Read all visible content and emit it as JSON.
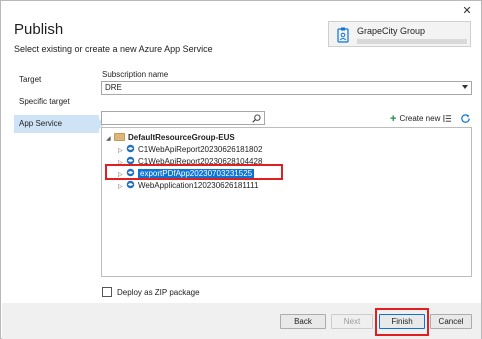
{
  "window": {
    "title": "Publish",
    "subtitle": "Select existing or create a new Azure App Service",
    "close_glyph": "✕"
  },
  "account": {
    "name": "GrapeCity Group",
    "icon": "account-badge-icon"
  },
  "sidebar": {
    "items": [
      {
        "label": "Target",
        "active": false
      },
      {
        "label": "Specific target",
        "active": false
      },
      {
        "label": "App Service",
        "active": true
      }
    ]
  },
  "subscription": {
    "label": "Subscription name",
    "value": "DRE"
  },
  "search": {
    "value": "",
    "placeholder": "",
    "icon": "search-icon"
  },
  "toolbar": {
    "create_new_label": "Create new",
    "plus_glyph": "+",
    "filter_icon": "filter-icon",
    "refresh_icon": "refresh-icon"
  },
  "tree": {
    "group": {
      "label": "DefaultResourceGroup-EUS",
      "expanded": true
    },
    "apps": [
      {
        "label": "C1WebApiReport20230626181802",
        "selected": false
      },
      {
        "label": "C1WebApiReport20230628104428",
        "selected": false
      },
      {
        "label": "exportPDfApp20230703231525",
        "selected": true
      },
      {
        "label": "WebApplication120230626181111",
        "selected": false
      }
    ]
  },
  "options": {
    "zip_label": "Deploy as ZIP package",
    "zip_checked": false
  },
  "buttons": {
    "back": "Back",
    "next": "Next",
    "finish": "Finish",
    "cancel": "Cancel"
  },
  "colors": {
    "selection": "#0b74d6",
    "highlight_box": "#e02020",
    "active_nav": "#cfe3f7",
    "create_new_plus": "#1e8e3e"
  }
}
